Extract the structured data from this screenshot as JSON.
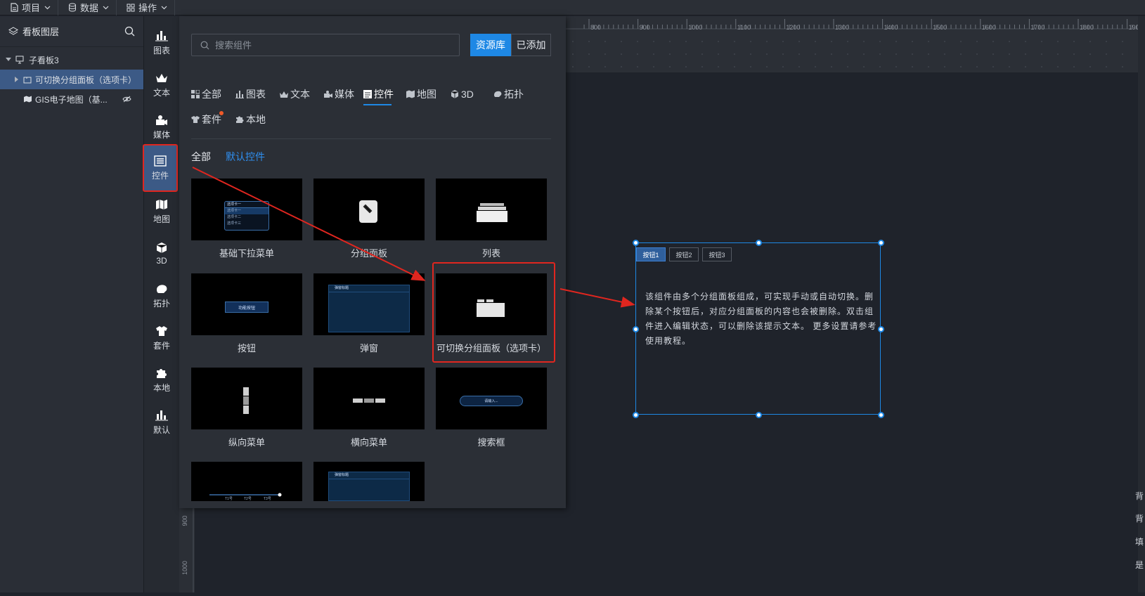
{
  "topbar": {
    "menus": [
      {
        "label": "项目",
        "icon": "file-icon"
      },
      {
        "label": "数据",
        "icon": "database-icon"
      },
      {
        "label": "操作",
        "icon": "grid-icon"
      }
    ]
  },
  "layers": {
    "title": "看板图层",
    "items": [
      {
        "label": "子看板3",
        "icon": "monitor-icon"
      },
      {
        "label": "可切换分组面板（选项卡）",
        "icon": "tabs-icon"
      },
      {
        "label": "GIS电子地图（基...",
        "icon": "map-icon",
        "hidden": true
      }
    ]
  },
  "rail": {
    "items": [
      {
        "label": "图表",
        "icon": "bar-chart-icon"
      },
      {
        "label": "文本",
        "icon": "crown-icon"
      },
      {
        "label": "媒体",
        "icon": "camera-icon"
      },
      {
        "label": "控件",
        "icon": "list-icon",
        "active": true
      },
      {
        "label": "地图",
        "icon": "map-icon"
      },
      {
        "label": "3D",
        "icon": "cube-icon"
      },
      {
        "label": "拓扑",
        "icon": "topology-icon"
      },
      {
        "label": "套件",
        "icon": "shirt-icon"
      },
      {
        "label": "本地",
        "icon": "puzzle-icon"
      },
      {
        "label": "默认",
        "icon": "bar-chart-icon"
      }
    ]
  },
  "library": {
    "search_placeholder": "搜索组件",
    "seg_library": "资源库",
    "seg_added": "已添加",
    "tabs": [
      {
        "label": "全部",
        "icon": "grid-icon"
      },
      {
        "label": "图表",
        "icon": "bar-chart-icon"
      },
      {
        "label": "文本",
        "icon": "crown-icon"
      },
      {
        "label": "媒体",
        "icon": "camera-icon"
      },
      {
        "label": "控件",
        "icon": "list-icon",
        "active": true
      },
      {
        "label": "地图",
        "icon": "map-icon"
      },
      {
        "label": "3D",
        "icon": "cube-icon"
      },
      {
        "label": "拓扑",
        "icon": "topology-icon"
      },
      {
        "label": "套件",
        "icon": "shirt-icon",
        "badge": true
      },
      {
        "label": "本地",
        "icon": "puzzle-icon"
      }
    ],
    "sub_all": "全部",
    "sub_default": "默认控件",
    "cards": [
      {
        "label": "基础下拉菜单",
        "thumb": "dropdown"
      },
      {
        "label": "分组面板",
        "thumb": "group"
      },
      {
        "label": "列表",
        "thumb": "list"
      },
      {
        "label": "按钮",
        "thumb": "button"
      },
      {
        "label": "弹窗",
        "thumb": "popup"
      },
      {
        "label": "可切换分组面板（选项卡）",
        "thumb": "folder",
        "highlighted": true
      },
      {
        "label": "纵向菜单",
        "thumb": "vmenu"
      },
      {
        "label": "横向菜单",
        "thumb": "hmenu"
      },
      {
        "label": "搜索框",
        "thumb": "searchbox"
      },
      {
        "label": "",
        "thumb": "timeline"
      },
      {
        "label": "",
        "thumb": "popup2"
      }
    ],
    "thumb_text": {
      "dropdown_items": [
        "选项卡一",
        "选项卡一",
        "选项卡二",
        "选项卡三"
      ],
      "button": "功能按钮",
      "popup_title": "弹窗标题",
      "search": "请输入...",
      "timeline": [
        "T1号",
        "T2号",
        "T3号"
      ]
    }
  },
  "ruler": {
    "top_ticks": [
      "800",
      "900",
      "1000",
      "1100",
      "1200",
      "1300",
      "1400",
      "1500",
      "1600",
      "1700",
      "1800",
      "1900"
    ],
    "left_ticks": [
      "900",
      "1000"
    ]
  },
  "canvas_widget": {
    "buttons": [
      "按钮1",
      "按钮2",
      "按钮3"
    ],
    "text": "该组件由多个分组面板组成，可实现手动或自动切换。删除某个按钮后，对应分组面板的内容也会被删除。双击组件进入编辑状态，可以删除该提示文本。 更多设置请参考使用教程。"
  },
  "side_hints": [
    "背",
    "背",
    "填",
    "是"
  ],
  "colors": {
    "accent": "#1e88e5",
    "highlight": "#e0261f",
    "selected_row": "#3c5a86"
  }
}
